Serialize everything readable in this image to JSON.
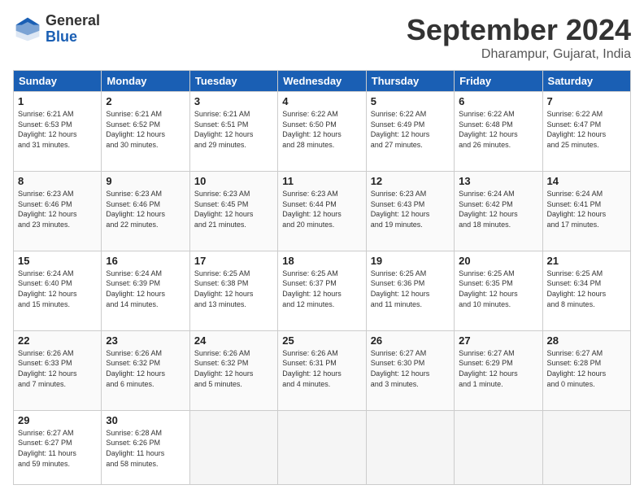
{
  "header": {
    "logo_general": "General",
    "logo_blue": "Blue",
    "month_title": "September 2024",
    "location": "Dharampur, Gujarat, India"
  },
  "weekdays": [
    "Sunday",
    "Monday",
    "Tuesday",
    "Wednesday",
    "Thursday",
    "Friday",
    "Saturday"
  ],
  "weeks": [
    [
      {
        "day": "1",
        "lines": [
          "Sunrise: 6:21 AM",
          "Sunset: 6:53 PM",
          "Daylight: 12 hours",
          "and 31 minutes."
        ]
      },
      {
        "day": "2",
        "lines": [
          "Sunrise: 6:21 AM",
          "Sunset: 6:52 PM",
          "Daylight: 12 hours",
          "and 30 minutes."
        ]
      },
      {
        "day": "3",
        "lines": [
          "Sunrise: 6:21 AM",
          "Sunset: 6:51 PM",
          "Daylight: 12 hours",
          "and 29 minutes."
        ]
      },
      {
        "day": "4",
        "lines": [
          "Sunrise: 6:22 AM",
          "Sunset: 6:50 PM",
          "Daylight: 12 hours",
          "and 28 minutes."
        ]
      },
      {
        "day": "5",
        "lines": [
          "Sunrise: 6:22 AM",
          "Sunset: 6:49 PM",
          "Daylight: 12 hours",
          "and 27 minutes."
        ]
      },
      {
        "day": "6",
        "lines": [
          "Sunrise: 6:22 AM",
          "Sunset: 6:48 PM",
          "Daylight: 12 hours",
          "and 26 minutes."
        ]
      },
      {
        "day": "7",
        "lines": [
          "Sunrise: 6:22 AM",
          "Sunset: 6:47 PM",
          "Daylight: 12 hours",
          "and 25 minutes."
        ]
      }
    ],
    [
      {
        "day": "8",
        "lines": [
          "Sunrise: 6:23 AM",
          "Sunset: 6:46 PM",
          "Daylight: 12 hours",
          "and 23 minutes."
        ]
      },
      {
        "day": "9",
        "lines": [
          "Sunrise: 6:23 AM",
          "Sunset: 6:46 PM",
          "Daylight: 12 hours",
          "and 22 minutes."
        ]
      },
      {
        "day": "10",
        "lines": [
          "Sunrise: 6:23 AM",
          "Sunset: 6:45 PM",
          "Daylight: 12 hours",
          "and 21 minutes."
        ]
      },
      {
        "day": "11",
        "lines": [
          "Sunrise: 6:23 AM",
          "Sunset: 6:44 PM",
          "Daylight: 12 hours",
          "and 20 minutes."
        ]
      },
      {
        "day": "12",
        "lines": [
          "Sunrise: 6:23 AM",
          "Sunset: 6:43 PM",
          "Daylight: 12 hours",
          "and 19 minutes."
        ]
      },
      {
        "day": "13",
        "lines": [
          "Sunrise: 6:24 AM",
          "Sunset: 6:42 PM",
          "Daylight: 12 hours",
          "and 18 minutes."
        ]
      },
      {
        "day": "14",
        "lines": [
          "Sunrise: 6:24 AM",
          "Sunset: 6:41 PM",
          "Daylight: 12 hours",
          "and 17 minutes."
        ]
      }
    ],
    [
      {
        "day": "15",
        "lines": [
          "Sunrise: 6:24 AM",
          "Sunset: 6:40 PM",
          "Daylight: 12 hours",
          "and 15 minutes."
        ]
      },
      {
        "day": "16",
        "lines": [
          "Sunrise: 6:24 AM",
          "Sunset: 6:39 PM",
          "Daylight: 12 hours",
          "and 14 minutes."
        ]
      },
      {
        "day": "17",
        "lines": [
          "Sunrise: 6:25 AM",
          "Sunset: 6:38 PM",
          "Daylight: 12 hours",
          "and 13 minutes."
        ]
      },
      {
        "day": "18",
        "lines": [
          "Sunrise: 6:25 AM",
          "Sunset: 6:37 PM",
          "Daylight: 12 hours",
          "and 12 minutes."
        ]
      },
      {
        "day": "19",
        "lines": [
          "Sunrise: 6:25 AM",
          "Sunset: 6:36 PM",
          "Daylight: 12 hours",
          "and 11 minutes."
        ]
      },
      {
        "day": "20",
        "lines": [
          "Sunrise: 6:25 AM",
          "Sunset: 6:35 PM",
          "Daylight: 12 hours",
          "and 10 minutes."
        ]
      },
      {
        "day": "21",
        "lines": [
          "Sunrise: 6:25 AM",
          "Sunset: 6:34 PM",
          "Daylight: 12 hours",
          "and 8 minutes."
        ]
      }
    ],
    [
      {
        "day": "22",
        "lines": [
          "Sunrise: 6:26 AM",
          "Sunset: 6:33 PM",
          "Daylight: 12 hours",
          "and 7 minutes."
        ]
      },
      {
        "day": "23",
        "lines": [
          "Sunrise: 6:26 AM",
          "Sunset: 6:32 PM",
          "Daylight: 12 hours",
          "and 6 minutes."
        ]
      },
      {
        "day": "24",
        "lines": [
          "Sunrise: 6:26 AM",
          "Sunset: 6:32 PM",
          "Daylight: 12 hours",
          "and 5 minutes."
        ]
      },
      {
        "day": "25",
        "lines": [
          "Sunrise: 6:26 AM",
          "Sunset: 6:31 PM",
          "Daylight: 12 hours",
          "and 4 minutes."
        ]
      },
      {
        "day": "26",
        "lines": [
          "Sunrise: 6:27 AM",
          "Sunset: 6:30 PM",
          "Daylight: 12 hours",
          "and 3 minutes."
        ]
      },
      {
        "day": "27",
        "lines": [
          "Sunrise: 6:27 AM",
          "Sunset: 6:29 PM",
          "Daylight: 12 hours",
          "and 1 minute."
        ]
      },
      {
        "day": "28",
        "lines": [
          "Sunrise: 6:27 AM",
          "Sunset: 6:28 PM",
          "Daylight: 12 hours",
          "and 0 minutes."
        ]
      }
    ],
    [
      {
        "day": "29",
        "lines": [
          "Sunrise: 6:27 AM",
          "Sunset: 6:27 PM",
          "Daylight: 11 hours",
          "and 59 minutes."
        ]
      },
      {
        "day": "30",
        "lines": [
          "Sunrise: 6:28 AM",
          "Sunset: 6:26 PM",
          "Daylight: 11 hours",
          "and 58 minutes."
        ]
      },
      {
        "day": "",
        "lines": []
      },
      {
        "day": "",
        "lines": []
      },
      {
        "day": "",
        "lines": []
      },
      {
        "day": "",
        "lines": []
      },
      {
        "day": "",
        "lines": []
      }
    ]
  ]
}
